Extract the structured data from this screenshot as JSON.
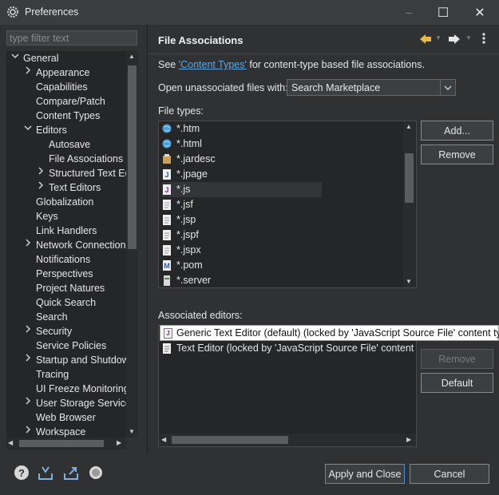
{
  "window": {
    "title": "Preferences",
    "minimize_icon": "─",
    "maximize_icon": "☐",
    "close_icon": "✕"
  },
  "sidebar": {
    "filter_placeholder": "type filter text",
    "tree": [
      {
        "label": "General",
        "depth": 0,
        "twisty": "expanded"
      },
      {
        "label": "Appearance",
        "depth": 1,
        "twisty": "collapsed"
      },
      {
        "label": "Capabilities",
        "depth": 1,
        "twisty": "none"
      },
      {
        "label": "Compare/Patch",
        "depth": 1,
        "twisty": "none"
      },
      {
        "label": "Content Types",
        "depth": 1,
        "twisty": "none"
      },
      {
        "label": "Editors",
        "depth": 1,
        "twisty": "expanded"
      },
      {
        "label": "Autosave",
        "depth": 2,
        "twisty": "none"
      },
      {
        "label": "File Associations",
        "depth": 2,
        "twisty": "none",
        "selected": true
      },
      {
        "label": "Structured Text Ed",
        "depth": 2,
        "twisty": "collapsed"
      },
      {
        "label": "Text Editors",
        "depth": 2,
        "twisty": "collapsed"
      },
      {
        "label": "Globalization",
        "depth": 1,
        "twisty": "none"
      },
      {
        "label": "Keys",
        "depth": 1,
        "twisty": "none"
      },
      {
        "label": "Link Handlers",
        "depth": 1,
        "twisty": "none"
      },
      {
        "label": "Network Connection",
        "depth": 1,
        "twisty": "collapsed"
      },
      {
        "label": "Notifications",
        "depth": 1,
        "twisty": "none"
      },
      {
        "label": "Perspectives",
        "depth": 1,
        "twisty": "none"
      },
      {
        "label": "Project Natures",
        "depth": 1,
        "twisty": "none"
      },
      {
        "label": "Quick Search",
        "depth": 1,
        "twisty": "none"
      },
      {
        "label": "Search",
        "depth": 1,
        "twisty": "none"
      },
      {
        "label": "Security",
        "depth": 1,
        "twisty": "collapsed"
      },
      {
        "label": "Service Policies",
        "depth": 1,
        "twisty": "none"
      },
      {
        "label": "Startup and Shutdow",
        "depth": 1,
        "twisty": "collapsed"
      },
      {
        "label": "Tracing",
        "depth": 1,
        "twisty": "none"
      },
      {
        "label": "UI Freeze Monitoring",
        "depth": 1,
        "twisty": "none"
      },
      {
        "label": "User Storage Service",
        "depth": 1,
        "twisty": "collapsed"
      },
      {
        "label": "Web Browser",
        "depth": 1,
        "twisty": "none"
      },
      {
        "label": "Workspace",
        "depth": 1,
        "twisty": "collapsed"
      }
    ]
  },
  "page": {
    "title": "File Associations",
    "see_prefix": "See ",
    "see_link": "'Content Types'",
    "see_suffix": " for content-type based file associations.",
    "open_unassociated_label": "Open unassociated files with:",
    "open_unassociated_value": "Search Marketplace",
    "file_types_label": "File types:",
    "file_types": [
      {
        "name": "*.htm",
        "icon": "globe-icon"
      },
      {
        "name": "*.html",
        "icon": "globe-icon"
      },
      {
        "name": "*.jardesc",
        "icon": "jar-icon"
      },
      {
        "name": "*.jpage",
        "icon": "java-icon"
      },
      {
        "name": "*.js",
        "icon": "javascript-icon",
        "selected": true
      },
      {
        "name": "*.jsf",
        "icon": "file-icon"
      },
      {
        "name": "*.jsp",
        "icon": "file-icon"
      },
      {
        "name": "*.jspf",
        "icon": "file-icon"
      },
      {
        "name": "*.jspx",
        "icon": "file-icon"
      },
      {
        "name": "*.pom",
        "icon": "maven-icon"
      },
      {
        "name": "*.server",
        "icon": "server-icon"
      }
    ],
    "buttons": {
      "add": "Add...",
      "remove": "Remove",
      "remove_editor": "Remove",
      "default": "Default"
    },
    "associated_editors_label": "Associated editors:",
    "editors": [
      {
        "name": "Generic Text Editor (default) (locked by 'JavaScript Source File' content type",
        "icon": "javascript-icon"
      },
      {
        "name": "Text Editor (locked by 'JavaScript Source File' content ty",
        "icon": "text-file-icon"
      }
    ]
  },
  "footer": {
    "apply_close": "Apply and Close",
    "cancel": "Cancel"
  },
  "colors": {
    "background": "#2f3133",
    "list_background": "#252628",
    "link": "#5fa8e6",
    "primary_border": "#4a8fd6"
  }
}
